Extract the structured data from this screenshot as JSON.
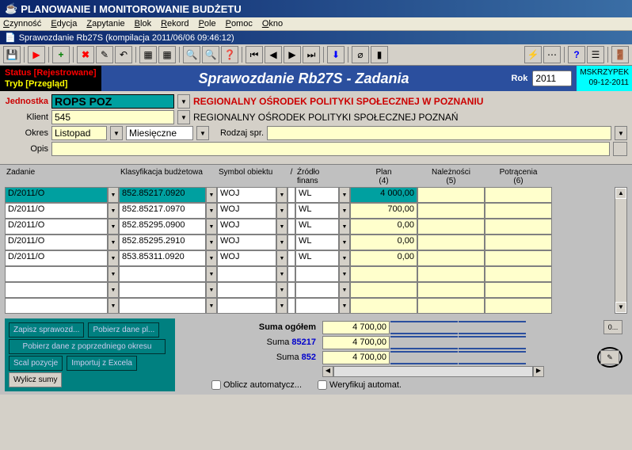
{
  "title": "PLANOWANIE I MONITOROWANIE BUDŻETU",
  "menu": [
    "Czynność",
    "Edycja",
    "Zapytanie",
    "Blok",
    "Rekord",
    "Pole",
    "Pomoc",
    "Okno"
  ],
  "subtitle": "Sprawozdanie Rb27S (kompilacja 2011/06/06 09:46:12)",
  "status1": "Status [Rejestrowane]",
  "status2": "Tryb [Przegląd]",
  "banner": "Sprawozdanie Rb27S - Zadania",
  "rok_label": "Rok",
  "rok_value": "2011",
  "user": "MSKRZYPEK",
  "date": "09-12-2011",
  "form": {
    "jednostka_label": "Jednostka",
    "jednostka_value": "ROPS POZ",
    "jednostka_desc": "REGIONALNY OŚRODEK POLITYKI SPOŁECZNEJ W POZNANIU",
    "klient_label": "Klient",
    "klient_value": "545",
    "klient_desc": "REGIONALNY OŚRODEK POLITYKI SPOŁECZNEJ POZNAŃ",
    "okres_label": "Okres",
    "okres_value": "Listopad",
    "okres_type": "Miesięczne",
    "rodzaj_label": "Rodzaj spr.",
    "rodzaj_value": "",
    "opis_label": "Opis",
    "opis_value": ""
  },
  "grid": {
    "headers": {
      "zadanie": "Zadanie",
      "klas": "Klasyfikacja budżetowa",
      "symbol": "Symbol obiektu",
      "sl": "/",
      "zrodlo": "Źródło finans",
      "plan": "Plan",
      "plan_n": "(4)",
      "nalez": "Należności",
      "nalez_n": "(5)",
      "potr": "Potrącenia",
      "potr_n": "(6)"
    },
    "rows": [
      {
        "zad": "D/2011/O",
        "klas": "852.85217.0920",
        "sym": "WOJ",
        "zrod": "WL",
        "plan": "4 000,00",
        "nalez": "",
        "potr": "",
        "sel": true
      },
      {
        "zad": "D/2011/O",
        "klas": "852.85217.0970",
        "sym": "WOJ",
        "zrod": "WL",
        "plan": "700,00",
        "nalez": "",
        "potr": ""
      },
      {
        "zad": "D/2011/O",
        "klas": "852.85295.0900",
        "sym": "WOJ",
        "zrod": "WL",
        "plan": "0,00",
        "nalez": "",
        "potr": ""
      },
      {
        "zad": "D/2011/O",
        "klas": "852.85295.2910",
        "sym": "WOJ",
        "zrod": "WL",
        "plan": "0,00",
        "nalez": "",
        "potr": ""
      },
      {
        "zad": "D/2011/O",
        "klas": "853.85311.0920",
        "sym": "WOJ",
        "zrod": "WL",
        "plan": "0,00",
        "nalez": "",
        "potr": ""
      },
      {
        "zad": "",
        "klas": "",
        "sym": "",
        "zrod": "",
        "plan": "",
        "nalez": "",
        "potr": ""
      },
      {
        "zad": "",
        "klas": "",
        "sym": "",
        "zrod": "",
        "plan": "",
        "nalez": "",
        "potr": ""
      },
      {
        "zad": "",
        "klas": "",
        "sym": "",
        "zrod": "",
        "plan": "",
        "nalez": "",
        "potr": ""
      }
    ]
  },
  "buttons": {
    "zapisz": "Zapisz sprawozd...",
    "pobierz_pl": "Pobierz dane pl...",
    "pobierz_okr": "Pobierz dane z poprzedniego okresu",
    "scal": "Scal pozycje",
    "import": "Importuj z Excela",
    "wylicz": "Wylicz sumy"
  },
  "sums": {
    "ogolem_label": "Suma ogółem",
    "ogolem_val": "4 700,00",
    "s1_label": "Suma ",
    "s1_code": "85217",
    "s1_val": "4 700,00",
    "s2_label": "Suma ",
    "s2_code": "852",
    "s2_val": "4 700,00"
  },
  "btn0": "0...",
  "checks": {
    "oblicz": "Oblicz automatycz...",
    "weryf": "Weryfikuj automat."
  },
  "chart_data": {
    "type": "table",
    "title": "Sprawozdanie Rb27S - Zadania",
    "columns": [
      "Zadanie",
      "Klasyfikacja budżetowa",
      "Symbol obiektu",
      "Źródło finans",
      "Plan (4)",
      "Należności (5)",
      "Potrącenia (6)"
    ],
    "rows": [
      [
        "D/2011/O",
        "852.85217.0920",
        "WOJ",
        "WL",
        4000.0,
        null,
        null
      ],
      [
        "D/2011/O",
        "852.85217.0970",
        "WOJ",
        "WL",
        700.0,
        null,
        null
      ],
      [
        "D/2011/O",
        "852.85295.0900",
        "WOJ",
        "WL",
        0.0,
        null,
        null
      ],
      [
        "D/2011/O",
        "852.85295.2910",
        "WOJ",
        "WL",
        0.0,
        null,
        null
      ],
      [
        "D/2011/O",
        "853.85311.0920",
        "WOJ",
        "WL",
        0.0,
        null,
        null
      ]
    ],
    "totals": {
      "Suma ogółem": 4700.0,
      "Suma 85217": 4700.0,
      "Suma 852": 4700.0
    }
  }
}
